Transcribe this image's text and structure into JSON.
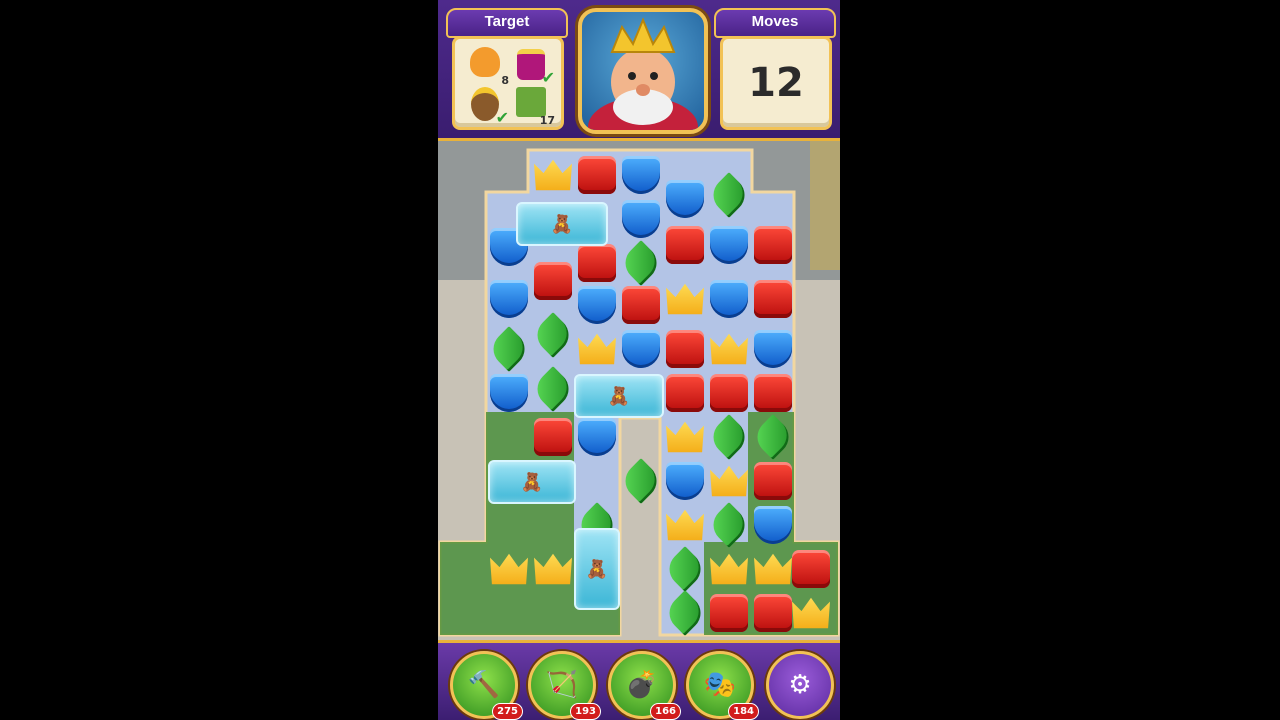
{
  "header": {
    "target_label": "Target",
    "moves_label": "Moves",
    "moves_value": "12",
    "targets": [
      {
        "icon": "teddy-bear-icon",
        "count": "8",
        "done": false
      },
      {
        "icon": "potion-jar-icon",
        "count": "",
        "done": true
      },
      {
        "icon": "mole-miner-icon",
        "count": "",
        "done": true
      },
      {
        "icon": "grass-tile-icon",
        "count": "17",
        "done": false
      }
    ]
  },
  "boosters": [
    {
      "name": "hammer-booster",
      "icon": "hammer-icon",
      "count": "275"
    },
    {
      "name": "arrow-booster",
      "icon": "bow-arrow-icon",
      "count": "193"
    },
    {
      "name": "cannon-booster",
      "icon": "cannon-icon",
      "count": "166"
    },
    {
      "name": "jester-hat-booster",
      "icon": "jester-hat-icon",
      "count": "184"
    }
  ],
  "settings_icon": "gear-icon",
  "colors": {
    "header": "#4e2a8c",
    "gold": "#f2c255",
    "board": "#b3c4e6"
  }
}
